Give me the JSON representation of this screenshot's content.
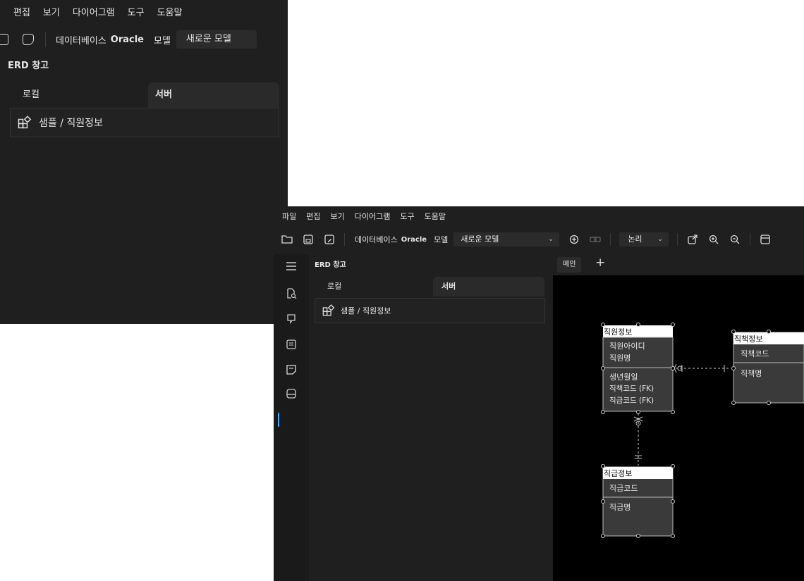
{
  "menu": [
    "파일",
    "편집",
    "보기",
    "다이어그램",
    "도구",
    "도움말"
  ],
  "back_menu": [
    "편집",
    "보기",
    "다이어그램",
    "도구",
    "도움말"
  ],
  "toolbar": {
    "database_label": "데이터베이스",
    "database_value": "Oracle",
    "model_label": "모델",
    "model_value": "새로운 모델",
    "view_value": "논리"
  },
  "panel": {
    "title": "ERD 창고",
    "tabs": [
      "로컬",
      "서버"
    ],
    "active_tab": "서버",
    "items": [
      "샘플 / 직원정보"
    ]
  },
  "canvas": {
    "tabs": [
      "메인"
    ],
    "add_tab": "+"
  },
  "erd": {
    "entities": [
      {
        "name": "직원정보",
        "pk": [
          "직원아이디",
          "직원명"
        ],
        "attrs": [
          "생년월일",
          "직책코드 (FK)",
          "직급코드 (FK)"
        ]
      },
      {
        "name": "직책정보",
        "pk": [
          "직책코드"
        ],
        "attrs": [
          "직책명"
        ]
      },
      {
        "name": "직급정보",
        "pk": [
          "직급코드"
        ],
        "attrs": [
          "직급명"
        ]
      }
    ]
  },
  "icons": {
    "sidebar": [
      "menu-icon",
      "document-search-icon",
      "idea-icon",
      "note-icon",
      "sticky-note-icon",
      "database-icon"
    ],
    "toolbar": [
      "folder-open-icon",
      "save-icon",
      "save-as-icon",
      "add-circle-icon",
      "link-icon",
      "export-icon",
      "zoom-in-icon",
      "zoom-out-icon",
      "window-icon"
    ],
    "list_item": "erd-model-icon"
  },
  "colors": {
    "window_bg": "#1f1f1f",
    "sidebar_bg": "#1a1a1a",
    "canvas_bg": "#000000",
    "entity_body": "#3a3a3a",
    "entity_header": "#ffffff",
    "accent": "#4aa3ff"
  }
}
